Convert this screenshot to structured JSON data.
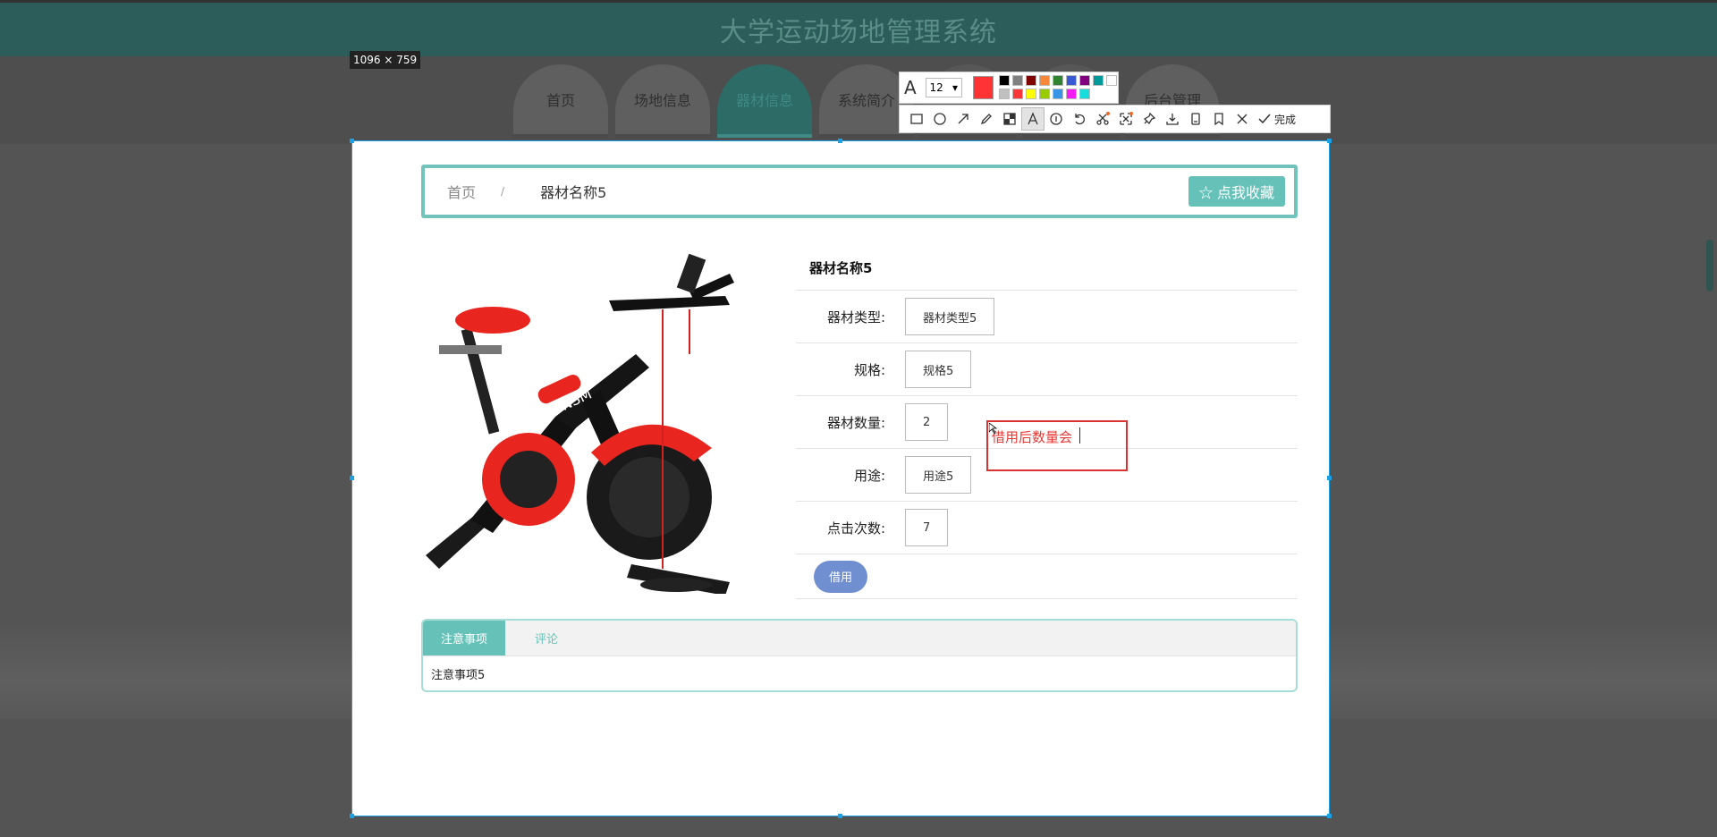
{
  "site": {
    "title": "大学运动场地管理系统",
    "nav": [
      {
        "label": "首页"
      },
      {
        "label": "场地信息"
      },
      {
        "label": "器材信息"
      },
      {
        "label": "系统简介"
      },
      {
        "label": ""
      },
      {
        "label": ""
      },
      {
        "label": "后台管理"
      }
    ]
  },
  "capture": {
    "size_label": "1096 × 759"
  },
  "breadcrumb": {
    "home": "首页",
    "separator": "/",
    "current": "器材名称5",
    "favorite_label": "☆ 点我收藏"
  },
  "product": {
    "title": "器材名称5",
    "fields": [
      {
        "label": "器材类型:",
        "value": "器材类型5"
      },
      {
        "label": "规格:",
        "value": "规格5"
      },
      {
        "label": "器材数量:",
        "value": "2"
      },
      {
        "label": "用途:",
        "value": "用途5"
      },
      {
        "label": "点击次数:",
        "value": "7"
      }
    ],
    "borrow_label": "借用"
  },
  "tabs": {
    "items": [
      {
        "label": "注意事项"
      },
      {
        "label": "评论"
      }
    ],
    "body": "注意事项5"
  },
  "annotation": {
    "text": "借用后数量会"
  },
  "toolbar": {
    "font_size": "12",
    "current_color": "#ff3333",
    "palette": [
      "#000000",
      "#808080",
      "#800000",
      "#f7883a",
      "#308430",
      "#385ad3",
      "#800080",
      "#009999",
      "#ffffff",
      "#c0c0c0",
      "#fb3838",
      "#ffff00",
      "#99cc00",
      "#3894e4",
      "#f31bf3",
      "#16dcdc"
    ],
    "tools": [
      "rectangle-icon",
      "ellipse-icon",
      "arrow-icon",
      "pencil-icon",
      "mosaic-icon",
      "text-icon",
      "serial-number-icon",
      "undo-icon",
      "ocr-icon",
      "pin-icon",
      "translate-icon",
      "download-icon",
      "long-screenshot-icon",
      "bookmark-icon"
    ],
    "done_label": "完成"
  }
}
